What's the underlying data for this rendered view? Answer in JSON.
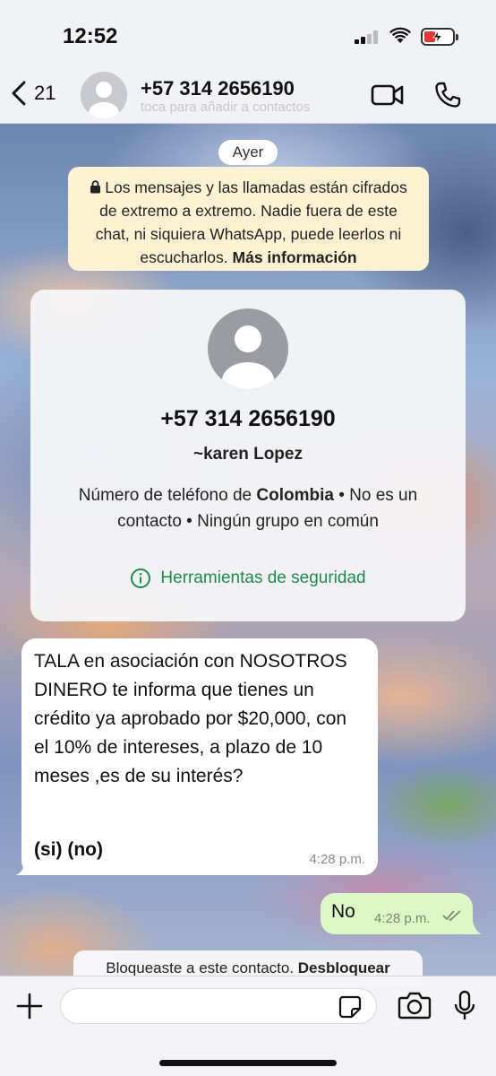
{
  "status_bar": {
    "time": "12:52",
    "battery_color": "#e53935"
  },
  "header": {
    "back_count": "21",
    "title": "+57 314 2656190",
    "subtitle": "toca para añadir a contactos",
    "icons": [
      "chevron-left-icon",
      "avatar",
      "video-icon",
      "phone-icon"
    ]
  },
  "chat": {
    "date_label": "Ayer",
    "encryption": {
      "text": "Los mensajes y las llamadas están cifrados de extremo a extremo. Nadie fuera de este chat, ni siquiera WhatsApp, puede leerlos ni escucharlos.",
      "link": "Más información"
    },
    "contact_card": {
      "number": "+57 314 2656190",
      "name": "~karen Lopez",
      "info_prefix": "Número de teléfono de ",
      "country": "Colombia",
      "info_suffix": " • No es un contacto • Ningún grupo en común",
      "tools_label": "Herramientas de seguridad"
    },
    "messages": [
      {
        "direction": "incoming",
        "text": "TALA en asociación con NOSOTROS DINERO te informa que tienes un crédito ya aprobado por $20,000, con el 10% de intereses, a plazo de 10 meses ,es de su interés?",
        "reply_options": "(si) (no)",
        "time": "4:28 p.m."
      },
      {
        "direction": "outgoing",
        "text": "No",
        "time": "4:28 p.m.",
        "status": "read"
      }
    ],
    "blocked_notice": {
      "text": "Bloqueaste a este contacto.",
      "link": "Desbloquear"
    }
  },
  "composer": {
    "placeholder": "",
    "value": ""
  },
  "colors": {
    "accent_green": "#1f8a4c",
    "outgoing_bubble": "#dcf8c6",
    "encryption_bg": "#fdf2d2"
  }
}
